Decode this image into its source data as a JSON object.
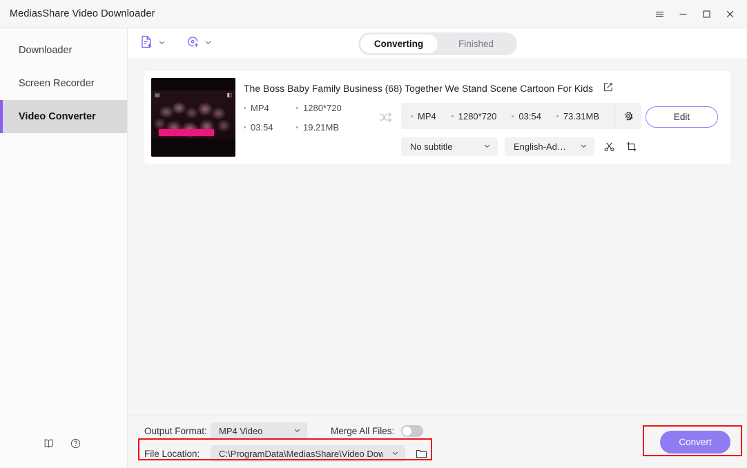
{
  "window": {
    "title": "MediasShare Video Downloader",
    "controls": [
      {
        "name": "menu-icon",
        "glyph": "menu"
      },
      {
        "name": "minimize-icon",
        "glyph": "minimize"
      },
      {
        "name": "maximize-icon",
        "glyph": "maximize"
      },
      {
        "name": "close-icon",
        "glyph": "close"
      }
    ]
  },
  "sidebar": {
    "items": [
      {
        "label": "Downloader",
        "active": false
      },
      {
        "label": "Screen Recorder",
        "active": false
      },
      {
        "label": "Video Converter",
        "active": true
      }
    ],
    "bottom_icons": [
      {
        "name": "manual-book-icon"
      },
      {
        "name": "help-icon"
      }
    ]
  },
  "toolbar": {
    "add_file_icon": "add-file-icon",
    "add_disc_icon": "add-disc-icon",
    "tabs": [
      {
        "label": "Converting",
        "active": true
      },
      {
        "label": "Finished",
        "active": false
      }
    ]
  },
  "task": {
    "title": "The Boss Baby Family Business (68)  Together We Stand Scene  Cartoon For Kids",
    "edit_title_icon": "edit-title-icon",
    "source": {
      "format": "MP4",
      "resolution": "1280*720",
      "duration": "03:54",
      "size": "19.21MB"
    },
    "swap_icon": "convert-arrows-icon",
    "output": {
      "format": "MP4",
      "resolution": "1280*720",
      "duration": "03:54",
      "size": "73.31MB",
      "settings_icon": "gear-icon"
    },
    "subtitle_select": "No subtitle",
    "audio_select": "English-Advan...",
    "trim_icon": "scissors-icon",
    "crop_icon": "crop-icon",
    "edit_button": "Edit"
  },
  "bottom": {
    "output_format_label": "Output Format:",
    "output_format_value": "MP4 Video",
    "merge_label": "Merge All Files:",
    "merge_enabled": false,
    "file_location_label": "File Location:",
    "file_location_value": "C:\\ProgramData\\MediasShare\\Video Downloa",
    "folder_icon": "folder-icon",
    "convert_button": "Convert"
  },
  "colors": {
    "accent": "#8b5cf6",
    "convert_button": "#8f7cf3",
    "highlight": "#f01414",
    "content_bg": "#f5f5f6"
  }
}
